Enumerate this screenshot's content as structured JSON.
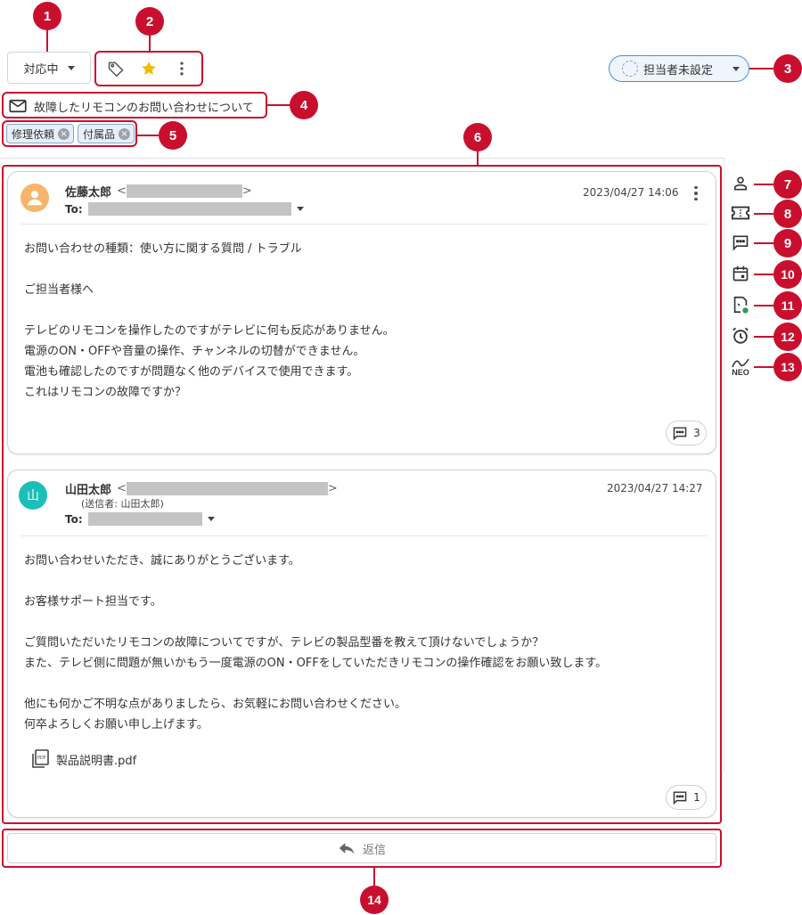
{
  "status": {
    "label": "対応中"
  },
  "assignee": {
    "label": "担当者未設定"
  },
  "subject": {
    "text": "故障したリモコンのお問い合わせについて"
  },
  "tags": [
    {
      "label": "修理依頼"
    },
    {
      "label": "付属品"
    }
  ],
  "messages": [
    {
      "sender_name": "佐藤太郎",
      "addr_open": "<",
      "addr_close": ">",
      "to_label": "To:",
      "date": "2023/04/27 14:06",
      "body": [
        "お問い合わせの種類：使い方に関する質問 / トラブル",
        "",
        "ご担当者様へ",
        "",
        "テレビのリモコンを操作したのですがテレビに何も反応がありません。",
        "電源のON・OFFや音量の操作、チャンネルの切替ができません。",
        "電池も確認したのですが問題なく他のデバイスで使用できます。",
        "これはリモコンの故障ですか？"
      ],
      "comment_count": "3",
      "avatar_color": "#f6b56b"
    },
    {
      "sender_name": "山田太郎",
      "avatar_char": "山",
      "addr_open": "<",
      "addr_close": ">",
      "sent_by": "(送信者: 山田太郎)",
      "to_label": "To:",
      "date": "2023/04/27 14:27",
      "body": [
        "お問い合わせいただき、誠にありがとうございます。",
        "",
        "お客様サポート担当です。",
        "",
        "ご質問いただいたリモコンの故障についてですが、テレビの製品型番を教えて頂けないでしょうか？",
        "また、テレビ側に問題が無いかもう一度電源のON・OFFをしていただきリモコンの操作確認をお願い致します。",
        "",
        "他にも何かご不明な点がありましたら、お気軽にお問い合わせください。",
        "何卒よろしくお願い申し上げます。"
      ],
      "attachment": "製品説明書.pdf",
      "comment_count": "1",
      "avatar_color": "#1bbfb8"
    }
  ],
  "reply": {
    "label": "返信"
  },
  "sidebar": {
    "neo_label": "NEO"
  },
  "badges": [
    "1",
    "2",
    "3",
    "4",
    "5",
    "6",
    "7",
    "8",
    "9",
    "10",
    "11",
    "12",
    "13",
    "14"
  ],
  "colors": {
    "accent_red": "#c8102e",
    "star": "#f5b800",
    "assignee_border": "#4a90d9",
    "tag_bg": "#e7eff8",
    "status_dot": "#2e9e4f"
  }
}
